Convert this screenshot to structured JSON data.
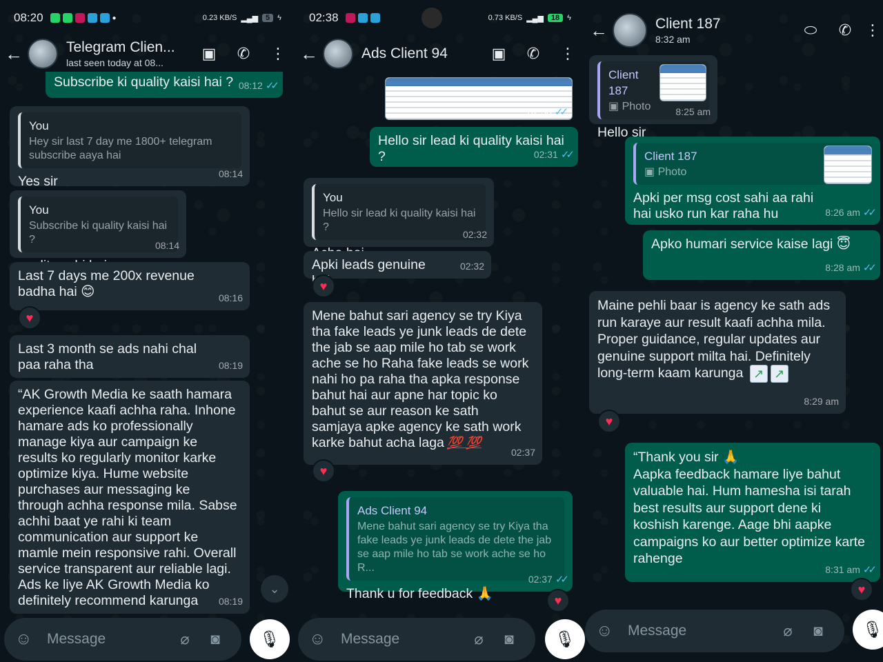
{
  "panel1": {
    "status": {
      "time": "08:20",
      "net": "0.23 KB/S",
      "battery": "5"
    },
    "header": {
      "name": "Telegram Clien...",
      "sub": "last seen today at 08..."
    },
    "top_partial": {
      "text": "Subscribe ki quality kaisi hai ?",
      "time": "08:12"
    },
    "messages": [
      {
        "quote_name": "You",
        "quote_text": "Hey sir last 7 day me 1800+ telegram subscribe aaya hai",
        "text": "Yes sir",
        "time": "08:14"
      },
      {
        "quote_name": "You",
        "quote_text": "Subscribe ki quality kaisi hai ?",
        "text": "quality sahi hai",
        "time": "08:14"
      },
      {
        "text": "Last 7 days me 200x revenue badha hai",
        "emoji": "😊",
        "time": "08:16",
        "reaction": "♥"
      },
      {
        "text": "Last 3 month se ads nahi chal paa raha tha",
        "time": "08:19"
      },
      {
        "text": "“AK Growth Media ke saath hamara experience kaafi achha raha. Inhone hamare ads ko professionally manage kiya aur campaign ke results ko regularly monitor karke optimize kiya. Hume website purchases aur messaging ke through achha response mila. Sabse achhi baat ye rahi ki team communication aur support ke mamle mein responsive rahi. Overall service transparent aur reliable lagi. Ads ke liye AK Growth Media ko definitely recommend karunga",
        "time": "08:19"
      }
    ],
    "input_placeholder": "Message"
  },
  "panel2": {
    "status": {
      "time": "02:38",
      "net": "0.73 KB/S",
      "battery": "18"
    },
    "header": {
      "name": "Ads Client 94"
    },
    "image_time": "02:30",
    "messages": [
      {
        "text": "Hello sir lead ki quality kaisi hai ?",
        "time": "02:31"
      },
      {
        "quote_name": "You",
        "quote_text": "Hello sir lead ki quality kaisi hai ?",
        "text": "Acha hai",
        "time": "02:32"
      },
      {
        "text": "Apki leads genuine hai",
        "time": "02:32",
        "reaction": "♥"
      },
      {
        "text": "Mene bahut sari agency se try Kiya tha fake leads ye junk leads de dete the jab se aap mile ho tab se work ache se ho Raha fake leads se work nahi ho pa raha tha apka response bahut hai aur apne har topic ko bahut se aur reason ke sath samjaya apke agency ke sath work karke bahut acha laga",
        "emoji": "💯 💯",
        "time": "02:37",
        "reaction": "♥"
      },
      {
        "quote_name": "Ads Client 94",
        "quote_text": "Mene bahut sari agency se try Kiya tha fake leads ye junk leads de dete the jab se aap mile ho tab se work ache se ho R...",
        "text": "Thank u for feedback",
        "emoji": "🙏",
        "time": "02:37",
        "reaction": "♥"
      }
    ],
    "input_placeholder": "Message"
  },
  "panel3": {
    "header": {
      "name": "Client 187",
      "sub": "8:32 am"
    },
    "messages": [
      {
        "quote_name": "Client 187",
        "quote_text": "Photo",
        "text": "Hello sir",
        "time": "8:25 am"
      },
      {
        "quote_name": "Client 187",
        "quote_text": "Photo",
        "text": "Apki per msg cost sahi aa rahi hai usko run kar raha hu",
        "time": "8:26 am"
      },
      {
        "text": "Apko humari service kaise lagi",
        "emoji": "😇",
        "time": "8:28 am"
      },
      {
        "text": "Maine pehli baar is agency ke sath ads run karaye aur result kaafi achha mila. Proper guidance, regular updates aur genuine support milta hai. Definitely long-term kaam karunga",
        "emoji": "📈📈",
        "time": "8:29 am",
        "reaction": "♥"
      },
      {
        "text": "“Thank you sir 🙏\nAapka feedback hamare liye bahut valuable hai. Hum hamesha isi tarah best results aur support dene ki koshish karenge. Aage bhi aapke campaigns ko aur better optimize karte rahenge",
        "time": "8:31 am",
        "reaction": "♥"
      }
    ],
    "input_placeholder": "Message"
  }
}
